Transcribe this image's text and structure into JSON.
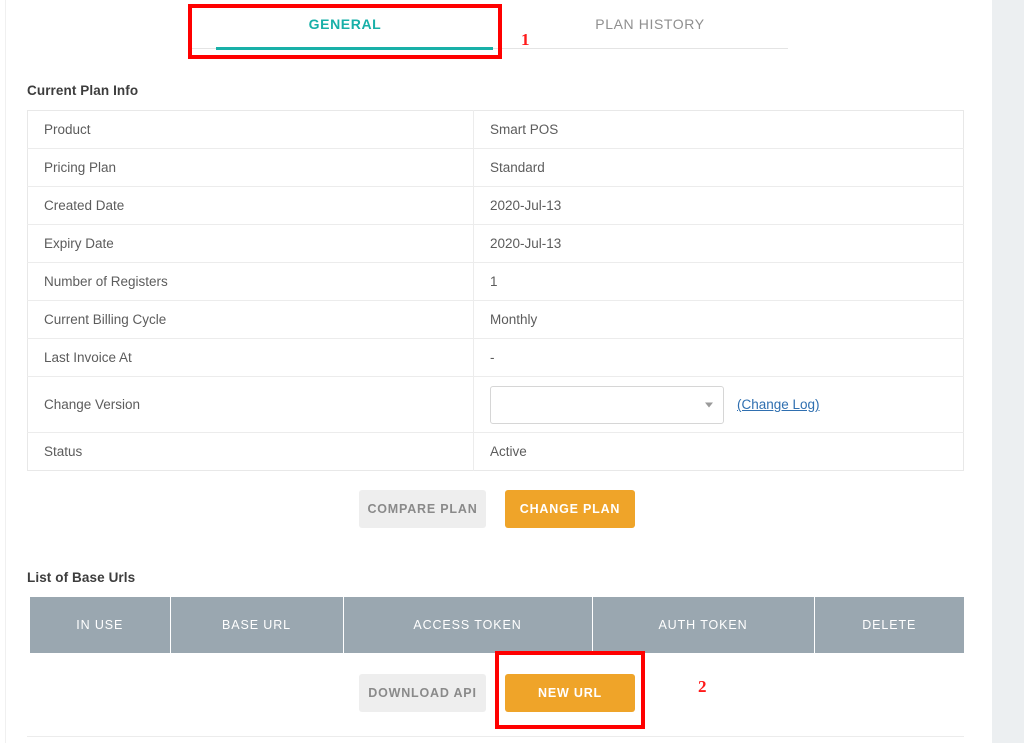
{
  "tabs": [
    {
      "id": "general",
      "label": "GENERAL",
      "active": true
    },
    {
      "id": "plan-history",
      "label": "PLAN HISTORY",
      "active": false
    }
  ],
  "sections": {
    "plan_info_title": "Current Plan Info",
    "base_urls_title": "List of Base Urls"
  },
  "plan_info": {
    "rows": [
      {
        "label": "Product",
        "value": "Smart POS"
      },
      {
        "label": "Pricing Plan",
        "value": "Standard"
      },
      {
        "label": "Created Date",
        "value": "2020-Jul-13"
      },
      {
        "label": "Expiry Date",
        "value": "2020-Jul-13"
      },
      {
        "label": "Number of Registers",
        "value": "1"
      },
      {
        "label": "Current Billing Cycle",
        "value": "Monthly"
      },
      {
        "label": "Last Invoice At",
        "value": "-"
      },
      {
        "label": "Change Version",
        "value": ""
      },
      {
        "label": "Status",
        "value": "Active"
      }
    ],
    "change_version": {
      "select_value": "",
      "select_placeholder": "",
      "caret_icon": "chevron-down-icon",
      "change_log_label": "(Change Log)"
    }
  },
  "plan_actions": {
    "compare_label": "COMPARE PLAN",
    "change_label": "CHANGE PLAN"
  },
  "base_urls": {
    "columns": [
      "IN USE",
      "BASE URL",
      "ACCESS TOKEN",
      "AUTH TOKEN",
      "DELETE"
    ],
    "rows": []
  },
  "url_actions": {
    "download_label": "DOWNLOAD API",
    "new_url_label": "NEW URL"
  },
  "annotations": [
    {
      "id": "1",
      "number": "1",
      "target": "general-tab"
    },
    {
      "id": "2",
      "number": "2",
      "target": "new-url-button"
    }
  ],
  "colors": {
    "accent_teal": "#18b0a8",
    "primary_orange": "#efa429",
    "table_header_gray": "#9aa7b0",
    "link_blue": "#2f6fb0",
    "annotation_red": "#ff0000",
    "page_gutter": "#eceff1"
  }
}
